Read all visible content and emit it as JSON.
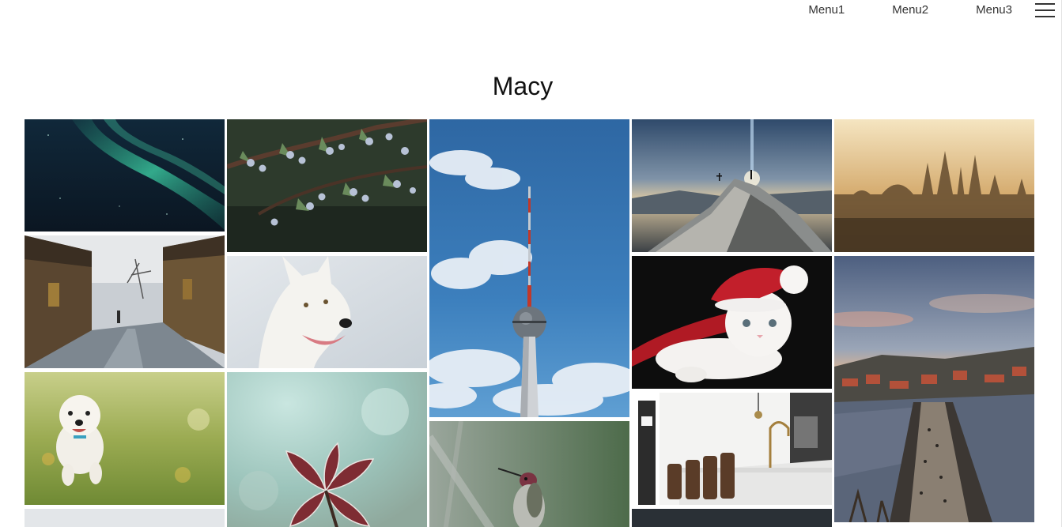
{
  "nav": {
    "items": [
      "Menu1",
      "Menu2",
      "Menu3"
    ],
    "menu_icon": "hamburger-menu-icon"
  },
  "page": {
    "title": "Macy"
  },
  "gallery": {
    "photos": [
      {
        "id": "aurora",
        "subject": "aurora-night-sky"
      },
      {
        "id": "alley",
        "subject": "rainy-street"
      },
      {
        "id": "poodle",
        "subject": "white-dog-running"
      },
      {
        "id": "juniper",
        "subject": "juniper-berries"
      },
      {
        "id": "white-dog",
        "subject": "white-shepherd-dog"
      },
      {
        "id": "frost-leaves",
        "subject": "frosted-red-leaves"
      },
      {
        "id": "tv-tower",
        "subject": "berlin-tv-tower"
      },
      {
        "id": "hummingbird",
        "subject": "hummingbird"
      },
      {
        "id": "mountain",
        "subject": "mountain-summit"
      },
      {
        "id": "santa-cat",
        "subject": "cat-in-santa-hat"
      },
      {
        "id": "kitchen",
        "subject": "kitchen-interior"
      },
      {
        "id": "gothic-city",
        "subject": "city-spires-sunrise"
      },
      {
        "id": "prague",
        "subject": "charles-bridge-prague"
      }
    ]
  }
}
